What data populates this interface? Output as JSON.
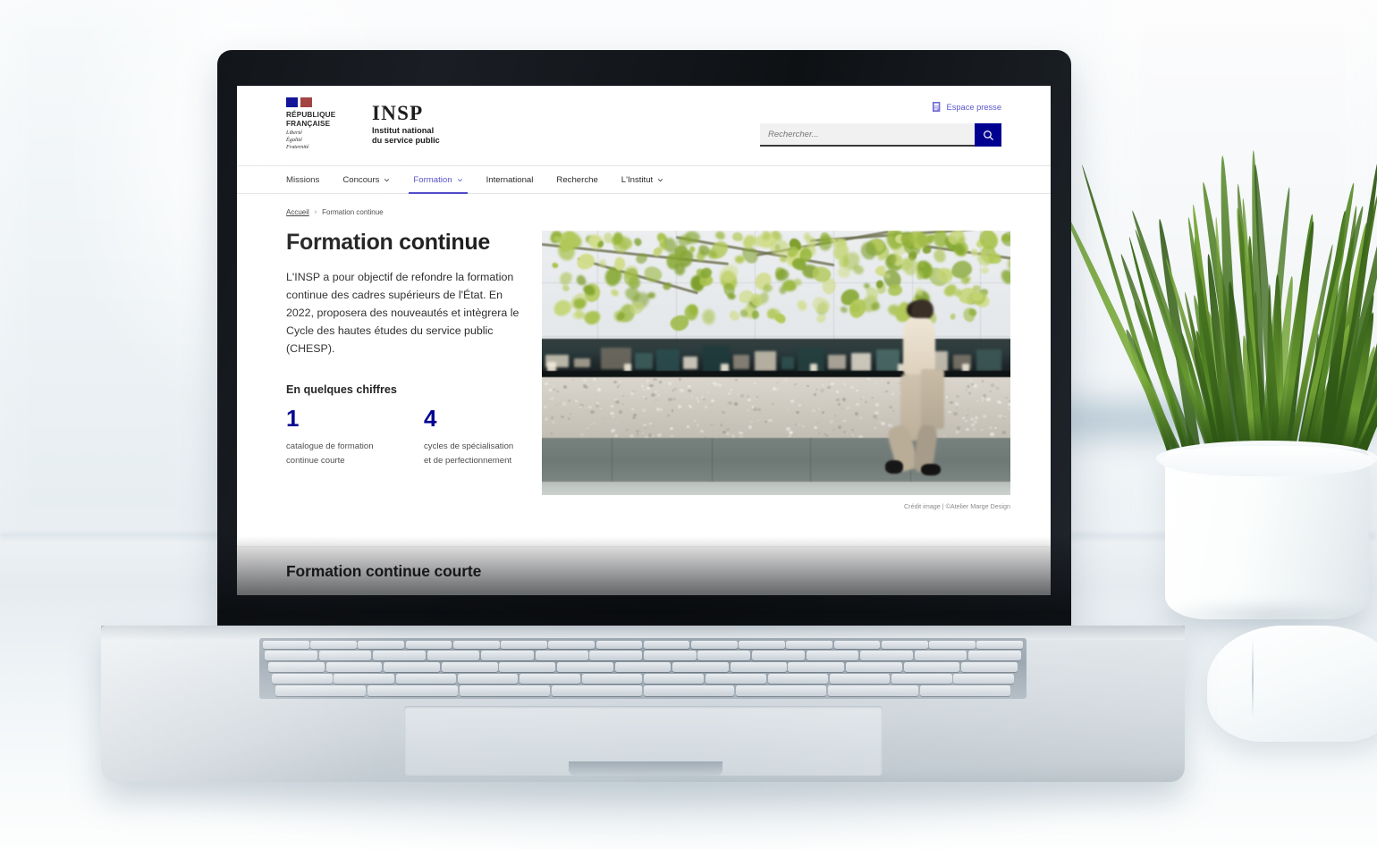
{
  "site": {
    "brand": {
      "republic_line1": "RÉPUBLIQUE",
      "republic_line2": "FRANÇAISE",
      "motto_line1": "Liberté",
      "motto_line2": "Égalité",
      "motto_line3": "Fraternité",
      "insp_acronym": "INSP",
      "insp_sub_line1": "Institut national",
      "insp_sub_line2": "du service public",
      "flag_blue": "#000091",
      "flag_red": "#9C3635"
    },
    "header": {
      "press_link": "Espace presse",
      "press_icon": "newspaper-icon"
    },
    "search": {
      "placeholder": "Rechercher...",
      "value": "",
      "button_icon": "search-icon",
      "button_color": "#000091"
    },
    "nav": {
      "active_color": "#5451C9",
      "items": [
        {
          "label": "Missions",
          "has_caret": false,
          "active": false
        },
        {
          "label": "Concours",
          "has_caret": true,
          "active": false
        },
        {
          "label": "Formation",
          "has_caret": true,
          "active": true
        },
        {
          "label": "International",
          "has_caret": false,
          "active": false
        },
        {
          "label": "Recherche",
          "has_caret": false,
          "active": false
        },
        {
          "label": "L'Institut",
          "has_caret": true,
          "active": false
        }
      ]
    },
    "breadcrumb": {
      "home": "Accueil",
      "separator": "›",
      "current": "Formation continue"
    },
    "hero": {
      "title": "Formation continue",
      "lead": "L'INSP a pour objectif de refondre la formation continue des cadres supérieurs de l'État. En 2022, proposera des nouveautés et intègrera le Cycle des hautes études du service public (CHESP).",
      "image_alt": "Femme marchant devant une façade vitrée sous un arbre",
      "image_credit": "Crédit image | ©Atelier Marge Design"
    },
    "figures": {
      "heading": "En quelques chiffres",
      "accent_color": "#000091",
      "items": [
        {
          "number": "1",
          "label": "catalogue de formation continue courte"
        },
        {
          "number": "4",
          "label": "cycles de spécialisation et de perfectionnement"
        }
      ]
    },
    "section": {
      "title": "Formation continue courte",
      "background": "#F6F6F6"
    }
  },
  "scene": {
    "device": "laptop",
    "surroundings": [
      "potted-grass-plant",
      "computer-mouse",
      "white-desk"
    ]
  }
}
